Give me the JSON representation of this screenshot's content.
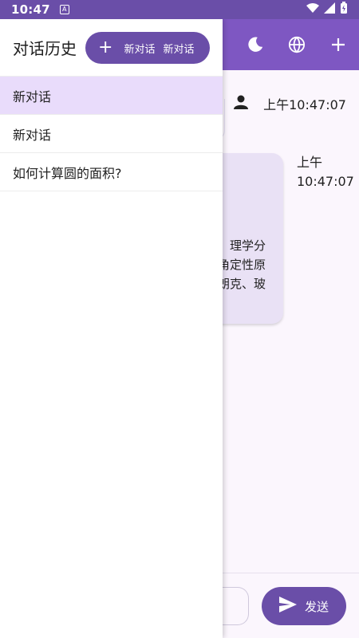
{
  "status_bar": {
    "time": "10:47",
    "badge": "A"
  },
  "drawer": {
    "title": "对话历史",
    "new_chat_label": "新对话",
    "new_chat_label_2": "新对话",
    "items": [
      {
        "label": "新对话",
        "active": true
      },
      {
        "label": "新对话",
        "active": false
      },
      {
        "label": "如何计算圆的面积?",
        "active": false
      }
    ]
  },
  "main": {
    "user_time": "上午10:47:07",
    "assistant_time_line1": "上午",
    "assistant_time_line2": "10:47:07",
    "assistant_snippet": [
      "理学分",
      "角定性原",
      "朗克、玻"
    ]
  },
  "input": {
    "send_label": "发送"
  },
  "colors": {
    "primary": "#6a4ea8",
    "app_bar": "#7e57c2",
    "active_item": "#e9dcfb",
    "bubble": "#e9e1f5"
  },
  "icons": [
    "moon-icon",
    "globe-icon",
    "plus-icon",
    "person-icon",
    "send-icon",
    "wifi-icon",
    "signal-icon",
    "battery-icon"
  ]
}
